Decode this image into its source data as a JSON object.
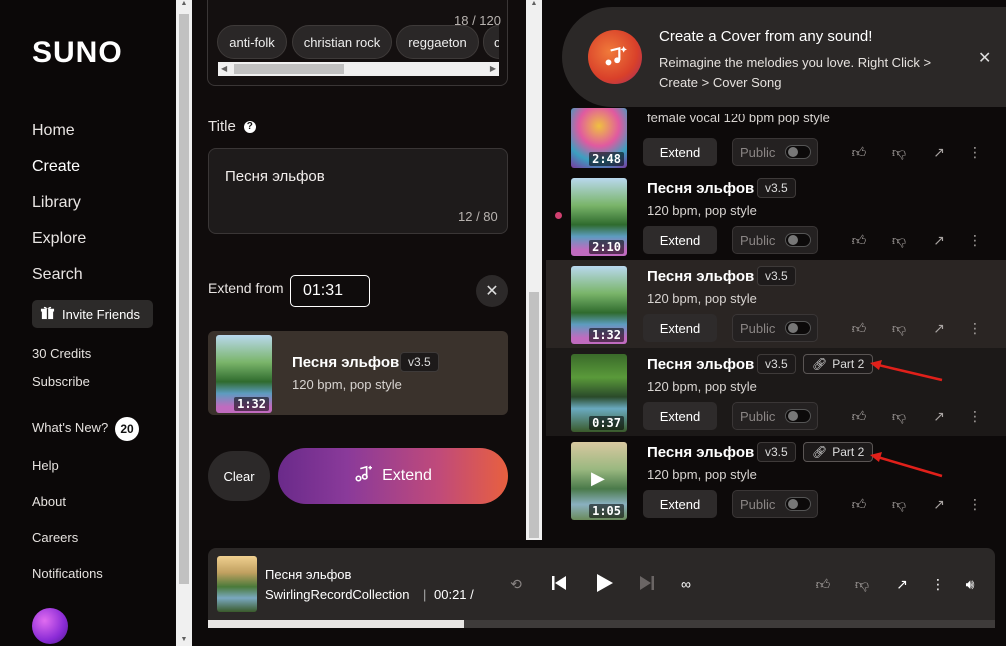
{
  "sidebar": {
    "logo": "SUNO",
    "nav": [
      "Home",
      "Create",
      "Library",
      "Explore",
      "Search"
    ],
    "invite_label": "Invite Friends",
    "credits": "30 Credits",
    "subscribe": "Subscribe",
    "whats_new": "What's New?",
    "whats_new_count": "20",
    "help": "Help",
    "about": "About",
    "careers": "Careers",
    "notifications": "Notifications"
  },
  "create": {
    "tags_counter": "18 / 120",
    "tags": [
      "anti-folk",
      "christian rock",
      "reggaeton",
      "c"
    ],
    "title_label": "Title",
    "title_value": "Песня эльфов",
    "title_count": "12 / 80",
    "extend_from_label": "Extend from",
    "extend_from_value": "01:31",
    "selected_song": {
      "title": "Песня эльфов",
      "version": "v3.5",
      "subtitle": "120 bpm, pop style",
      "duration": "1:32"
    },
    "clear_label": "Clear",
    "extend_label": "Extend"
  },
  "toast": {
    "title": "Create a Cover from any sound!",
    "body": "Reimagine the melodies you love. Right Click > Create > Cover Song"
  },
  "feed": {
    "extend_label": "Extend",
    "public_label": "Public",
    "rows": [
      {
        "title": "",
        "subtitle": "female vocal 120 bpm pop style",
        "duration": "2:48",
        "version": "",
        "part": ""
      },
      {
        "title": "Песня эльфов",
        "subtitle": "120 bpm, pop style",
        "duration": "2:10",
        "version": "v3.5",
        "part": ""
      },
      {
        "title": "Песня эльфов",
        "subtitle": "120 bpm, pop style",
        "duration": "1:32",
        "version": "v3.5",
        "part": ""
      },
      {
        "title": "Песня эльфов",
        "subtitle": "120 bpm, pop style",
        "duration": "0:37",
        "version": "v3.5",
        "part": "Part 2"
      },
      {
        "title": "Песня эльфов",
        "subtitle": "120 bpm, pop style",
        "duration": "1:05",
        "version": "v3.5",
        "part": "Part 2"
      }
    ]
  },
  "player": {
    "title": "Песня эльфов",
    "artist": "SwirlingRecordCollection",
    "separator": "|",
    "time": "00:21 /",
    "progress": 0.325
  },
  "colors": {
    "accent_pink": "#d04070",
    "arrow_red": "#e0201a"
  }
}
